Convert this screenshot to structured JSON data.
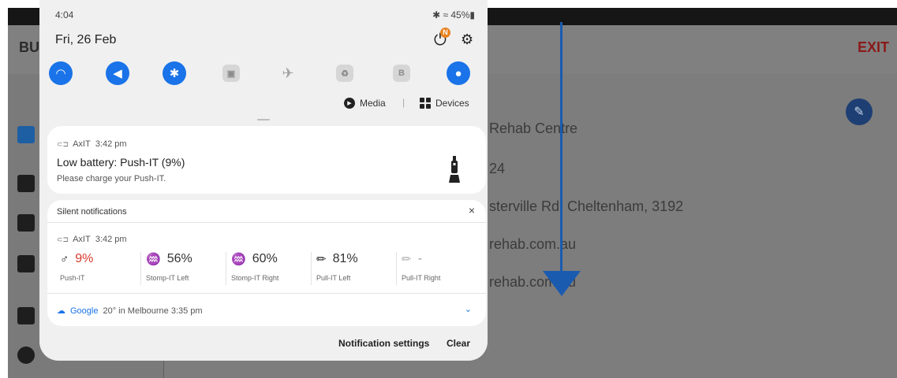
{
  "background_app": {
    "title": "BU",
    "exit_label": "EXIT",
    "edit_icon": "pencil-icon",
    "info_lines": [
      "Rehab Centre",
      "24",
      "sterville Rd, Cheltenham, 3192",
      "rehab.com.au",
      "rehab.com.au"
    ]
  },
  "shade": {
    "status_time": "4:04",
    "status_right": "✱ ≈ 45%▮",
    "date": "Fri, 26 Feb",
    "power_badge": "N",
    "quick_settings": [
      {
        "name": "wifi",
        "state": "on",
        "glyph": "◠"
      },
      {
        "name": "sound",
        "state": "on",
        "glyph": "◀"
      },
      {
        "name": "bluetooth",
        "state": "on",
        "glyph": "✱"
      },
      {
        "name": "lock-rotation",
        "state": "off",
        "glyph": "▣"
      },
      {
        "name": "airplane",
        "state": "off",
        "glyph": "✈"
      },
      {
        "name": "power-saving",
        "state": "off",
        "glyph": "♻"
      },
      {
        "name": "battery-b",
        "state": "off",
        "glyph": "B"
      },
      {
        "name": "location",
        "state": "on",
        "glyph": "●"
      }
    ],
    "media_label": "Media",
    "devices_label": "Devices",
    "separator": "|"
  },
  "notification_low_battery": {
    "app": "AxIT",
    "time": "3:42 pm",
    "title": "Low battery: Push-IT (9%)",
    "body": "Please charge your Push-IT."
  },
  "silent": {
    "header": "Silent notifications",
    "close": "×",
    "app": "AxIT",
    "time": "3:42 pm",
    "devices": [
      {
        "name": "Push-IT",
        "value": "9%",
        "level": 0.09,
        "status": "low",
        "glyph": "♂"
      },
      {
        "name": "Stomp-IT Left",
        "value": "56%",
        "level": 0.56,
        "status": "ok",
        "glyph": "♒"
      },
      {
        "name": "Stomp-IT Right",
        "value": "60%",
        "level": 0.6,
        "status": "ok",
        "glyph": "♒"
      },
      {
        "name": "Pull-IT Left",
        "value": "81%",
        "level": 0.81,
        "status": "ok",
        "glyph": "✏"
      },
      {
        "name": "Pull-IT Right",
        "value": "-",
        "level": null,
        "status": "disconnected",
        "glyph": "✏"
      }
    ]
  },
  "google": {
    "app": "Google",
    "text": "20° in Melbourne  3:35 pm"
  },
  "footer": {
    "settings_label": "Notification settings",
    "clear_label": "Clear"
  },
  "colors": {
    "accent": "#1a73e8",
    "low_battery": "#d83a2c",
    "badge": "#e8821e",
    "swipe_arrow": "#1a5bb0"
  }
}
